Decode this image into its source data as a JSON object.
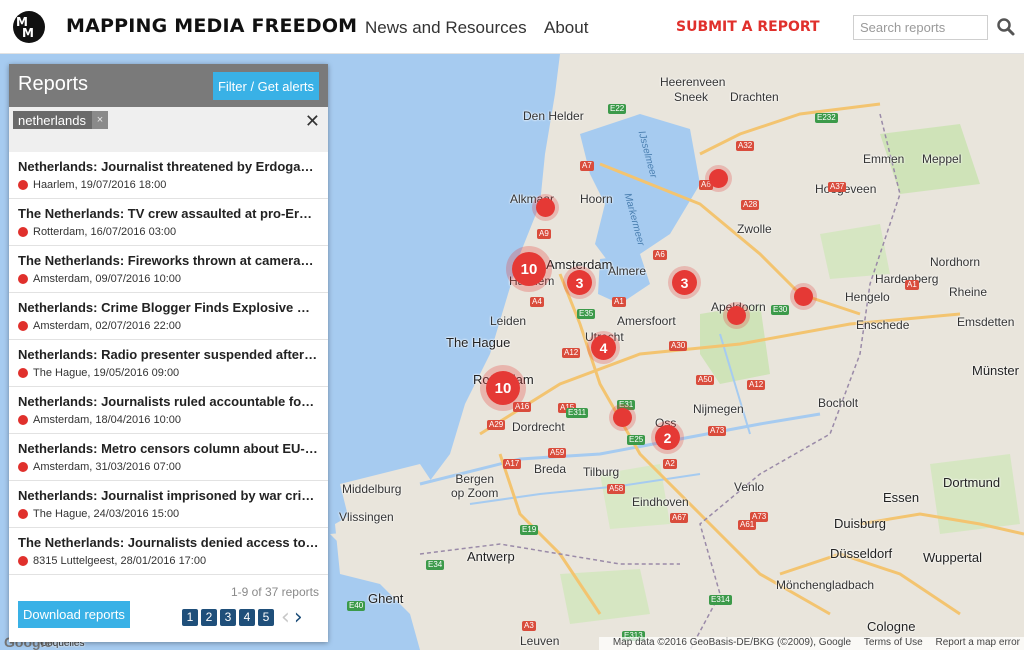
{
  "header": {
    "brand": "MAPPING MEDIA FREEDOM",
    "logo_text": "MMF",
    "nav": {
      "news": "News and Resources",
      "about": "About",
      "submit": "SUBMIT A REPORT"
    },
    "search": {
      "placeholder": "Search reports",
      "icon": "search-icon"
    }
  },
  "panel": {
    "title": "Reports",
    "filter_label": "Filter / Get alerts",
    "active_tag": "netherlands",
    "tag_remove": "×",
    "clear": "✕",
    "reports": [
      {
        "title": "Netherlands: Journalist threatened by Erdogan su...",
        "meta": "Haarlem, 19/07/2016 18:00"
      },
      {
        "title": "The Netherlands: TV crew assaulted at pro-Erdoga...",
        "meta": "Rotterdam, 16/07/2016 03:00"
      },
      {
        "title": "The Netherlands: Fireworks thrown at cameraman...",
        "meta": "Amsterdam, 09/07/2016 10:00"
      },
      {
        "title": "Netherlands: Crime Blogger Finds Explosive Device...",
        "meta": "Amsterdam, 02/07/2016 22:00"
      },
      {
        "title": "Netherlands: Radio presenter suspended after crit...",
        "meta": "The Hague, 19/05/2016 09:00"
      },
      {
        "title": "Netherlands: Journalists ruled accountable for da...",
        "meta": "Amsterdam, 18/04/2016 10:00"
      },
      {
        "title": "Netherlands: Metro censors column about EU-Ukr...",
        "meta": "Amsterdam, 31/03/2016 07:00"
      },
      {
        "title": "Netherlands: Journalist imprisoned by war crimes ...",
        "meta": "The Hague, 24/03/2016 15:00"
      },
      {
        "title": "The Netherlands: Journalists denied access to mee...",
        "meta": "8315 Luttelgeest, 28/01/2016 17:00"
      }
    ],
    "count": "1-9 of 37 reports",
    "download_label": "Download reports",
    "pages": [
      "1",
      "2",
      "3",
      "4",
      "5"
    ],
    "prev": "‹",
    "next": "›"
  },
  "map": {
    "clusters": [
      "10",
      "3",
      "3",
      "4",
      "10",
      "2"
    ],
    "places": {
      "den_helder": "Den Helder",
      "sneek": "Sneek",
      "heerenveen": "Heerenveen",
      "drachten": "Drachten",
      "emmen": "Emmen",
      "meppel": "Meppel",
      "hardenberg": "Hardenberg",
      "hoogeveen": "Hoogeveen",
      "zwolle": "Zwolle",
      "hoorn": "Hoorn",
      "alkmaar": "Alkmaar",
      "amsterdam": "Amsterdam",
      "almere": "Almere",
      "haarlem": "Haarlem",
      "leiden": "Leiden",
      "the_hague": "The Hague",
      "utrecht": "Utrecht",
      "amersfoort": "Amersfoort",
      "apeldoorn": "Apeldoorn",
      "nordhorn": "Nordhorn",
      "rheine": "Rheine",
      "hengelo": "Hengelo",
      "enschede": "Enschede",
      "emsdetten": "Emsdetten",
      "rotterdam": "Rotterdam",
      "dordrecht": "Dordrecht",
      "nijmegen": "Nijmegen",
      "oss": "Oss",
      "munster": "Münster",
      "bocholt": "Bocholt",
      "breda": "Breda",
      "tilburg": "Tilburg",
      "middelburg": "Middelburg",
      "vlissingen": "Vlissingen",
      "bergen_op_zoom": "Bergen\nop Zoom",
      "eindhoven": "Eindhoven",
      "venlo": "Venlo",
      "essen": "Essen",
      "dortmund": "Dortmund",
      "duisburg": "Duisburg",
      "antwerp": "Antwerp",
      "dusseldorf": "Düsseldorf",
      "wuppertal": "Wuppertal",
      "monchengladbach": "Mönchengladbach",
      "ghent": "Ghent",
      "leuven": "Leuven",
      "cologne": "Cologne",
      "coquelles": "Coquelles"
    },
    "water": {
      "ijsselmeer": "IJsselmeer",
      "markermeer": "Markermeer"
    },
    "roads": [
      "E22",
      "A7",
      "A32",
      "E232",
      "A6",
      "A28",
      "A37",
      "A9",
      "A4",
      "A1",
      "E35",
      "A12",
      "A30",
      "E30",
      "A50",
      "A12",
      "A15",
      "A16",
      "A29",
      "E311",
      "E31",
      "E25",
      "A73",
      "A59",
      "A17",
      "A58",
      "A2",
      "A67",
      "E19",
      "E34",
      "A73",
      "A61",
      "E40",
      "A3",
      "E313",
      "E314",
      "A1",
      "A6"
    ],
    "footer": {
      "copy": "Map data ©2016 GeoBasis-DE/BKG (©2009), Google",
      "terms": "Terms of Use",
      "report": "Report a map error"
    },
    "google": "Google"
  },
  "colors": {
    "accent": "#39b1e6",
    "brand_red": "#e0302c",
    "cluster": "#e53935",
    "pager": "#1f4f7a",
    "water": "#a6cbf0",
    "land": "#e9e5dc"
  }
}
